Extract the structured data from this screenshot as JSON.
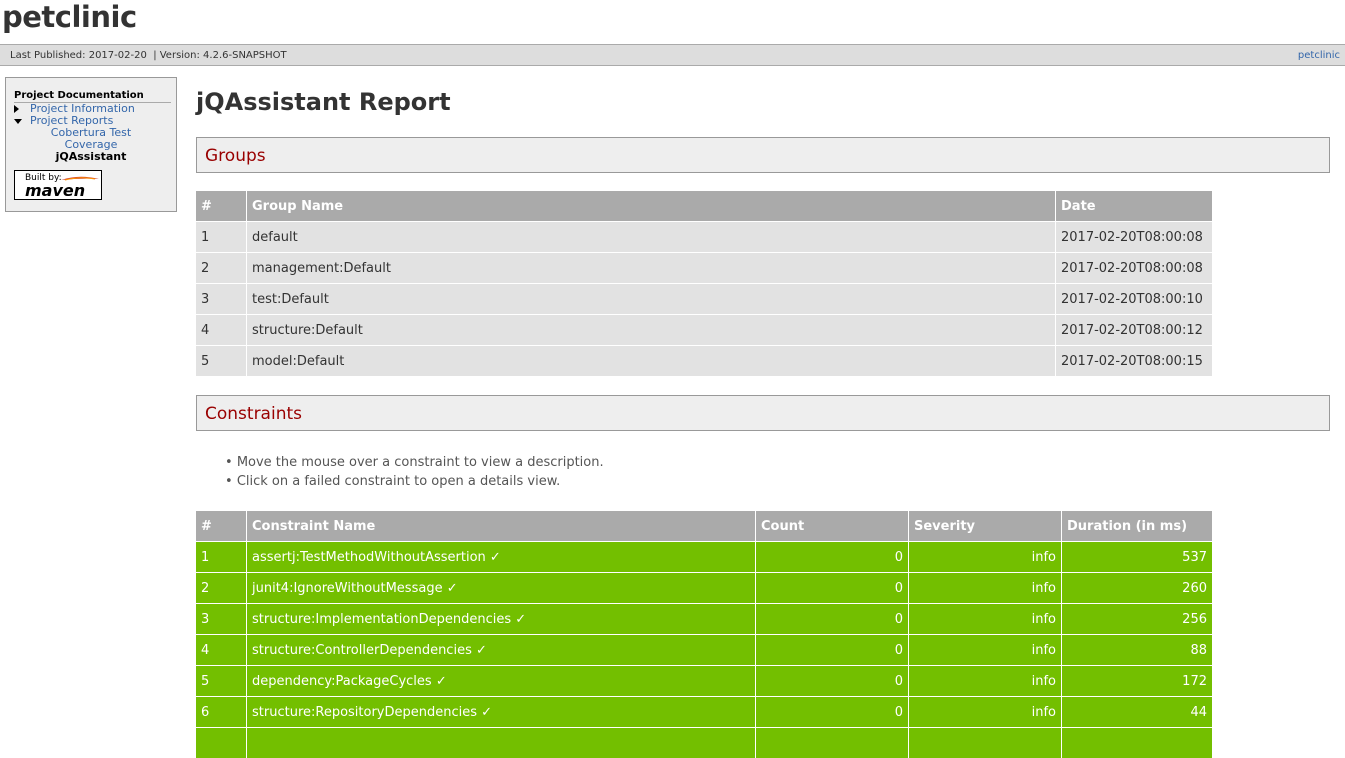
{
  "site": {
    "title": "petclinic",
    "published": "Last Published: 2017-02-20",
    "version": "| Version: 4.2.6-SNAPSHOT",
    "home_link": "petclinic"
  },
  "nav": {
    "heading": "Project Documentation",
    "items": [
      {
        "label": "Project Information",
        "expanded": false
      },
      {
        "label": "Project Reports",
        "expanded": true
      }
    ],
    "subitems": [
      "Cobertura Test Coverage",
      "jQAssistant"
    ],
    "maven_badge": {
      "built_by": "Built by:",
      "name": "maven"
    }
  },
  "page": {
    "title": "jQAssistant Report",
    "groups_heading": "Groups",
    "constraints_heading": "Constraints",
    "notes": [
      "Move the mouse over a constraint to view a description.",
      "Click on a failed constraint to open a details view."
    ]
  },
  "groups_table": {
    "headers": [
      "#",
      "Group Name",
      "Date"
    ],
    "rows": [
      [
        "1",
        "default",
        "2017-02-20T08:00:08"
      ],
      [
        "2",
        "management:Default",
        "2017-02-20T08:00:08"
      ],
      [
        "3",
        "test:Default",
        "2017-02-20T08:00:10"
      ],
      [
        "4",
        "structure:Default",
        "2017-02-20T08:00:12"
      ],
      [
        "5",
        "model:Default",
        "2017-02-20T08:00:15"
      ]
    ]
  },
  "constraints_table": {
    "headers": [
      "#",
      "Constraint Name",
      "Count",
      "Severity",
      "Duration (in ms)"
    ],
    "rows": [
      [
        "1",
        "assertj:TestMethodWithoutAssertion ✓",
        "0",
        "info",
        "537"
      ],
      [
        "2",
        "junit4:IgnoreWithoutMessage ✓",
        "0",
        "info",
        "260"
      ],
      [
        "3",
        "structure:ImplementationDependencies ✓",
        "0",
        "info",
        "256"
      ],
      [
        "4",
        "structure:ControllerDependencies ✓",
        "0",
        "info",
        "88"
      ],
      [
        "5",
        "dependency:PackageCycles ✓",
        "0",
        "info",
        "172"
      ],
      [
        "6",
        "structure:RepositoryDependencies ✓",
        "0",
        "info",
        "44"
      ]
    ]
  },
  "colors": {
    "success_row": "#73bf00",
    "section_title": "#990000",
    "link": "#3366aa"
  }
}
